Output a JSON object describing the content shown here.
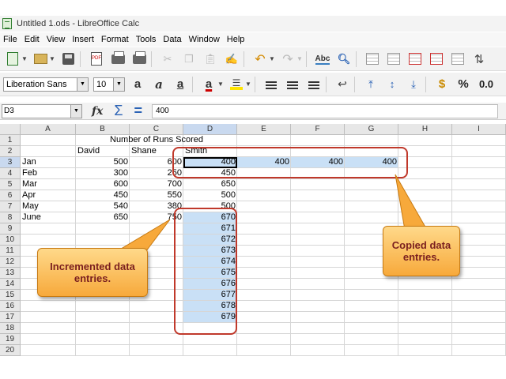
{
  "window": {
    "title": "Untitled 1.ods - LibreOffice Calc"
  },
  "menu": [
    "File",
    "Edit",
    "View",
    "Insert",
    "Format",
    "Tools",
    "Data",
    "Window",
    "Help"
  ],
  "formatting": {
    "font_name": "Liberation Sans",
    "font_size": "10",
    "percent_label": "%",
    "decimal_label": "0.0"
  },
  "formula_bar": {
    "name_box": "D3",
    "formula": "400"
  },
  "sheet": {
    "columns": [
      "A",
      "B",
      "C",
      "D",
      "E",
      "F",
      "G",
      "H",
      "I"
    ],
    "rows": [
      "1",
      "2",
      "3",
      "4",
      "5",
      "6",
      "7",
      "8",
      "9",
      "10",
      "11",
      "12",
      "13",
      "14",
      "15",
      "16",
      "17",
      "18",
      "19",
      "20"
    ],
    "title": "Number of Runs Scored",
    "header_row": [
      "",
      "David",
      "Shane",
      "Smith"
    ],
    "data_rows": [
      [
        "Jan",
        "500",
        "600",
        "400",
        "400",
        "400",
        "400"
      ],
      [
        "Feb",
        "300",
        "250",
        "450"
      ],
      [
        "Mar",
        "600",
        "700",
        "650"
      ],
      [
        "Apr",
        "450",
        "550",
        "500"
      ],
      [
        "May",
        "540",
        "380",
        "500"
      ],
      [
        "June",
        "650",
        "750",
        "670"
      ]
    ],
    "increment_values": [
      "671",
      "672",
      "673",
      "674",
      "675",
      "676",
      "677",
      "678",
      "679"
    ]
  },
  "callouts": {
    "incremented": "Incremented data entries.",
    "copied": "Copied data entries."
  },
  "colors": {
    "callout_fill": "#f7a93b",
    "callout_text": "#7a1f1f",
    "frame": "#c0392b",
    "selection": "#c9e0f6"
  }
}
